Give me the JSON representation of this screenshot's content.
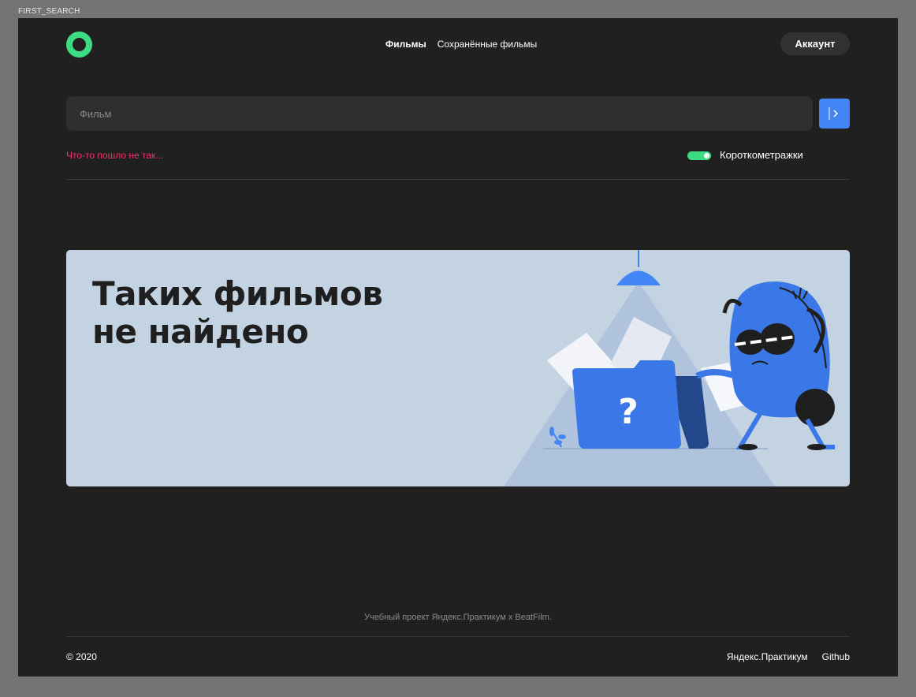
{
  "frame_label": "FIRST_SEARCH",
  "header": {
    "nav": [
      {
        "label": "Фильмы",
        "active": true
      },
      {
        "label": "Сохранённые фильмы",
        "active": false
      }
    ],
    "account_label": "Аккаунт"
  },
  "search": {
    "placeholder": "Фильм",
    "value": "",
    "error": "Что-то пошло не так...",
    "short_films_label": "Короткометражки",
    "short_films_enabled": true
  },
  "not_found": {
    "title_line1": "Таких фильмов",
    "title_line2": "не найдено"
  },
  "footer": {
    "project": "Учебный проект Яндекс.Практикум х BeatFilm.",
    "copyright": "© 2020",
    "links": [
      "Яндекс.Практикум",
      "Github"
    ]
  },
  "colors": {
    "accent_green": "#3ddc84",
    "accent_blue": "#4285f4",
    "error_red": "#ee3465",
    "background": "#202020"
  }
}
